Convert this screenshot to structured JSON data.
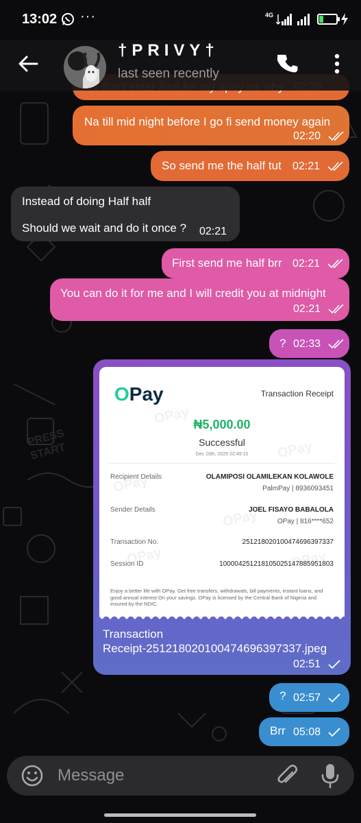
{
  "status_bar": {
    "time": "13:02",
    "overflow": "···",
    "network": "4G",
    "battery": "23"
  },
  "header": {
    "name": "†PRIVY†",
    "status": "last seen recently"
  },
  "messages": [
    {
      "text": "I don't enter limit for my opay na why",
      "time": "02:20"
    },
    {
      "text": "Na till mid night before I go fi send money again",
      "time": "02:20"
    },
    {
      "text": "So send me the half tut",
      "time": "02:21"
    },
    {
      "text_line1": "Instead of doing Half half",
      "text_line2": "Should we wait and do it once ?",
      "time": "02:21"
    },
    {
      "text": "First send me half brr",
      "time": "02:21"
    },
    {
      "text": "You can do it for me and I will credit you at midnight",
      "time": "02:21"
    },
    {
      "text": "?",
      "time": "02:33"
    },
    {
      "caption_line1": "Transaction",
      "caption_line2": "Receipt-251218020100474696397337.jpeg",
      "time": "02:51"
    },
    {
      "text": "?",
      "time": "02:57"
    },
    {
      "text": "Brr",
      "time": "05:08"
    }
  ],
  "receipt": {
    "logo_o": "O",
    "logo_rest": "Pay",
    "title": "Transaction Receipt",
    "amount": "₦5,000.00",
    "status": "Successful",
    "date": "Dec 18th, 2025 02:49:15",
    "recipient_label": "Recipient Details",
    "recipient_name": "OLAMIPOSI OLAMILEKAN KOLAWOLE",
    "recipient_bank": "PalmPay | 8936093451",
    "sender_label": "Sender Details",
    "sender_name": "JOEL FISAYO BABALOLA",
    "sender_bank": "OPay | 816****652",
    "txn_label": "Transaction No.",
    "txn_value": "251218020100474696397337",
    "session_label": "Session ID",
    "session_value": "100004251218105025147885951803",
    "footer": "Enjoy a better life with OPay. Get free transfers, withdrawals, bill payments, instant loans, and good annual interest On your savings. OPay is licensed by the Central Bank of Nigeria and insured by the NDIC."
  },
  "input": {
    "placeholder": "Message"
  },
  "colors": {
    "orange": "#e26a35",
    "pink": "#df5aa7",
    "incoming": "#2e2e31",
    "blue": "#3a8ed0",
    "opay_green": "#1dcf9f"
  },
  "icons": [
    "whatsapp-icon",
    "signal-icon",
    "wifi-icon",
    "battery-icon",
    "charging-icon",
    "back-arrow-icon",
    "phone-icon",
    "more-vert-icon",
    "double-check-icon",
    "check-icon",
    "emoji-icon",
    "paperclip-icon",
    "mic-icon"
  ]
}
